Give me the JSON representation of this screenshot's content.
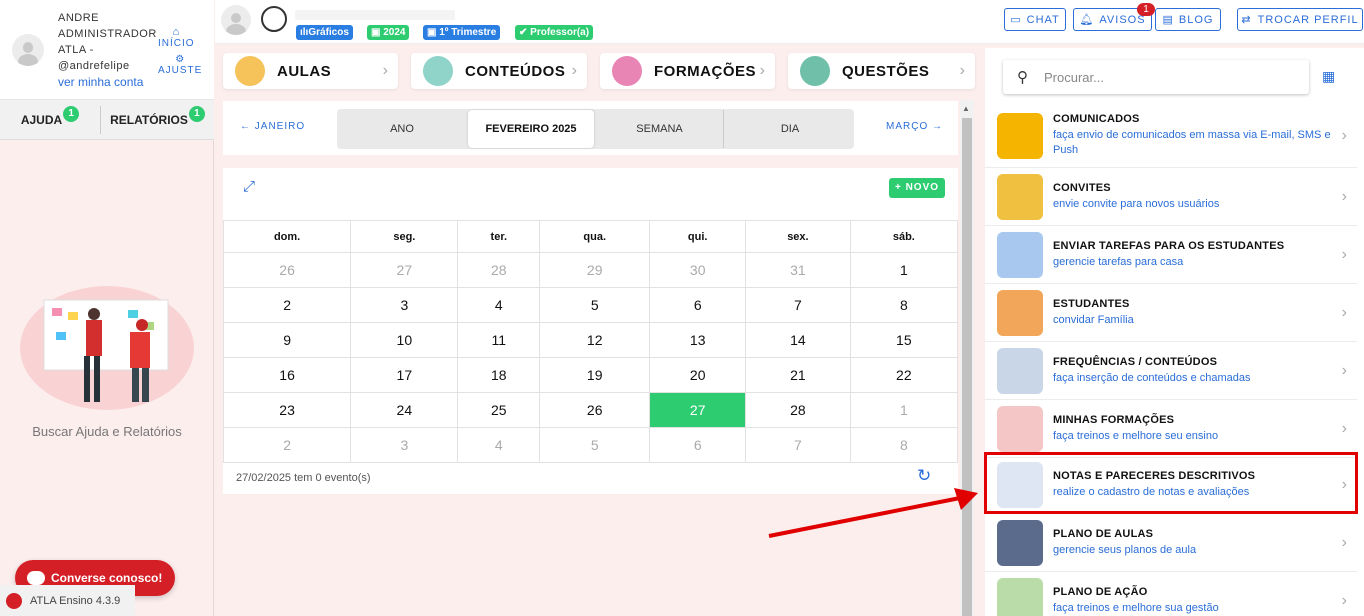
{
  "user": {
    "name": "ANDRE ADMINISTRADOR ATLA - @andrefelipe",
    "view_account": "ver minha conta",
    "inicio": "INÍCIO",
    "ajuste": "AJUSTE"
  },
  "sidebar": {
    "tabs": [
      {
        "label": "AJUDA",
        "badge": "1"
      },
      {
        "label": "RELATÓRIOS",
        "badge": "1"
      }
    ],
    "help_text": "Buscar Ajuda e Relatórios",
    "chat_label": "Converse conosco!",
    "version": "ATLA Ensino 4.3.9"
  },
  "topbar": {
    "pills": [
      {
        "label": "Gráficos",
        "color": "#2a7de1"
      },
      {
        "label": "2024",
        "color": "#2ecc71"
      },
      {
        "label": "1º Trimestre",
        "color": "#2a7de1"
      },
      {
        "label": "Professor(a)",
        "color": "#2ecc71"
      }
    ],
    "chat": "CHAT",
    "avisos": "AVISOS",
    "avisos_badge": "1",
    "blog": "BLOG",
    "trocar": "TROCAR PERFIL"
  },
  "cards": [
    "AULAS",
    "CONTEÚDOS",
    "FORMAÇÕES",
    "QUESTÕES"
  ],
  "calendar": {
    "prev": "← JANEIRO",
    "next": "MARÇO →",
    "views": [
      "ANO",
      "FEVEREIRO 2025",
      "SEMANA",
      "DIA"
    ],
    "new_label": "+ NOVO",
    "weekdays": [
      "dom.",
      "seg.",
      "ter.",
      "qua.",
      "qui.",
      "sex.",
      "sáb."
    ],
    "weeks": [
      [
        "26",
        "27",
        "28",
        "29",
        "30",
        "31",
        "1"
      ],
      [
        "2",
        "3",
        "4",
        "5",
        "6",
        "7",
        "8"
      ],
      [
        "9",
        "10",
        "11",
        "12",
        "13",
        "14",
        "15"
      ],
      [
        "16",
        "17",
        "18",
        "19",
        "20",
        "21",
        "22"
      ],
      [
        "23",
        "24",
        "25",
        "26",
        "27",
        "28",
        "1"
      ],
      [
        "2",
        "3",
        "4",
        "5",
        "6",
        "7",
        "8"
      ]
    ],
    "footer": "27/02/2025 tem 0 evento(s)"
  },
  "search_placeholder": "Procurar...",
  "menu": [
    {
      "title": "COMUNICADOS",
      "desc": "faça envio de comunicados em massa via E-mail, SMS e Push",
      "color": "#f4b400"
    },
    {
      "title": "CONVITES",
      "desc": "envie convite para novos usuários",
      "color": "#f0c040"
    },
    {
      "title": "ENVIAR TAREFAS PARA OS ESTUDANTES",
      "desc": "gerencie tarefas para casa",
      "color": "#a8c8f0"
    },
    {
      "title": "ESTUDANTES",
      "desc": "convidar Família",
      "color": "#f2a65a"
    },
    {
      "title": "FREQUÊNCIAS / CONTEÚDOS",
      "desc": "faça inserção de conteúdos e chamadas",
      "color": "#c8d6e8"
    },
    {
      "title": "MINHAS FORMAÇÕES",
      "desc": "faça treinos e melhore seu ensino",
      "color": "#f4c6c6"
    },
    {
      "title": "NOTAS E PARECERES DESCRITIVOS",
      "desc": "realize o cadastro de notas e avaliações",
      "color": "#dde6f2"
    },
    {
      "title": "PLANO DE AULAS",
      "desc": "gerencie seus planos de aula",
      "color": "#5a6b8c"
    },
    {
      "title": "PLANO DE AÇÃO",
      "desc": "faça treinos e melhore sua gestão",
      "color": "#b9dca8"
    }
  ]
}
